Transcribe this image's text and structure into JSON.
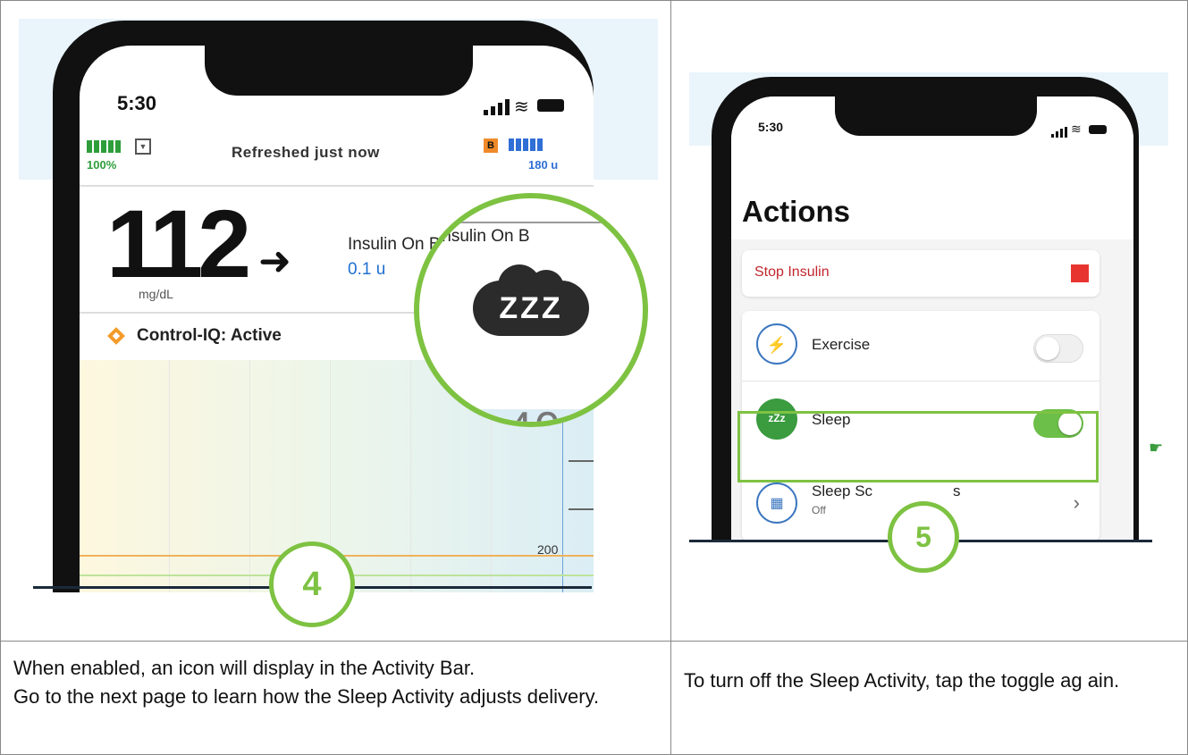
{
  "left_panel": {
    "phone": {
      "time": "5:30",
      "battery_percent": "100%",
      "refreshed": "Refreshed just now",
      "b_badge": "B",
      "insulin_units": "180 u",
      "glucose_value": "112",
      "trend_arrow": "➜",
      "glucose_unit": "mg/dL",
      "iob_label": "Insulin On Bo",
      "iob_value": "0.1 u",
      "control_iq": "Control-IQ: Active",
      "axis_label_200": "200",
      "zoom_top_text": "Insulin On B",
      "zoom_icon_text": "ZZZ",
      "zoom_bottom_text": "40"
    },
    "step_number": "4"
  },
  "right_panel": {
    "phone": {
      "time": "5:30",
      "title": "Actions",
      "stop_insulin": "Stop Insulin",
      "exercise": "Exercise",
      "sleep": "Sleep",
      "sleep_icon_text": "zZz",
      "sleep_schedules": "Sleep Sc",
      "sleep_schedules_tail": "s",
      "sleep_schedules_sub": "Off",
      "chevron": "›"
    },
    "step_number": "5",
    "tap_icon": "☛"
  },
  "captions": {
    "left": "When enabled, an icon will display in the Activity Bar.\nGo to the next page to learn how the Sleep Activity adjusts delivery.",
    "left_line1": "When enabled, an icon will display in the Activity Bar.",
    "left_line2": "Go to the next page to learn how the Sleep Activity adjusts delivery.",
    "right": "To turn off the Sleep Activity, tap the toggle ag ain."
  },
  "colors": {
    "accent_green": "#7ec242",
    "battery_green": "#2e9e3a",
    "insulin_blue": "#2f6fd6",
    "stop_red": "#e8342f"
  }
}
